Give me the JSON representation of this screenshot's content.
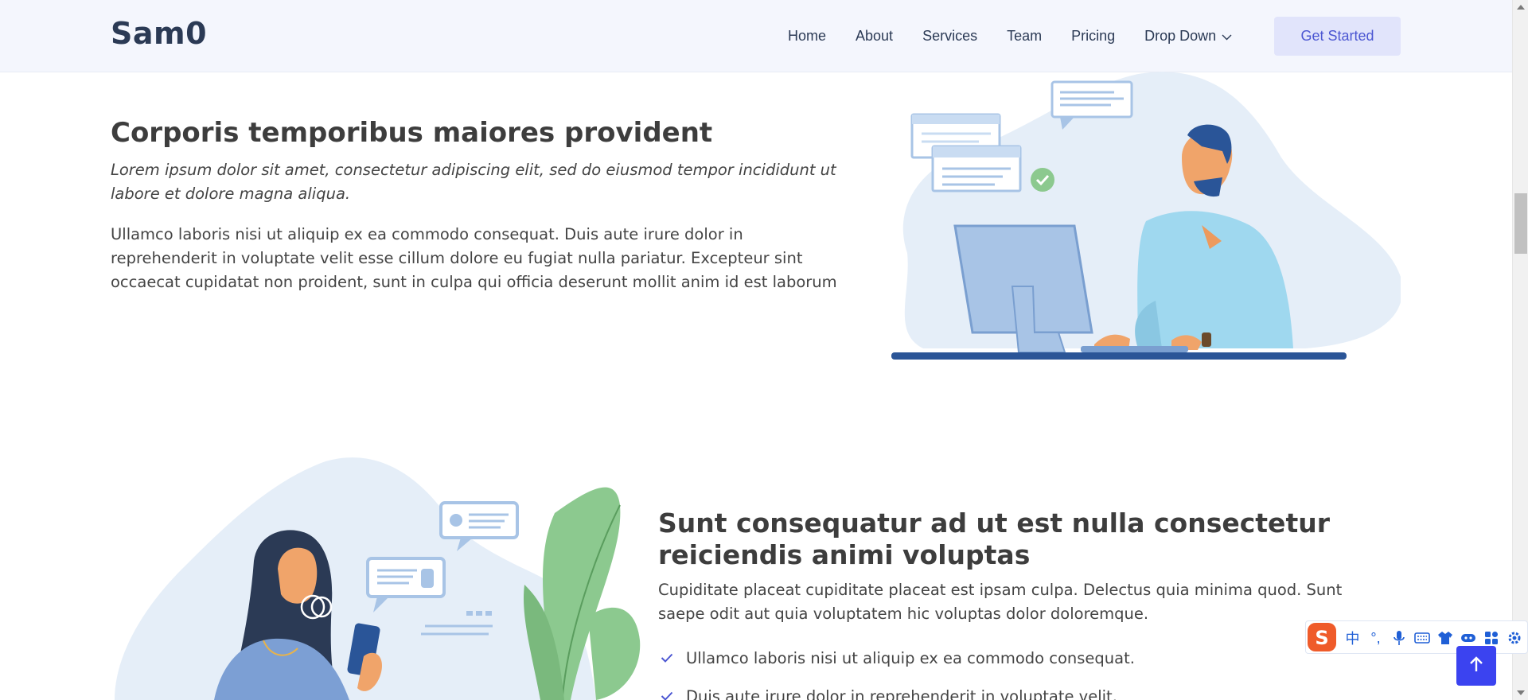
{
  "brand": {
    "name": "Sam0"
  },
  "nav": {
    "items": [
      {
        "label": "Home"
      },
      {
        "label": "About"
      },
      {
        "label": "Services"
      },
      {
        "label": "Team"
      },
      {
        "label": "Pricing"
      },
      {
        "label": "Drop Down"
      }
    ],
    "cta_label": "Get Started"
  },
  "section1": {
    "title": "Corporis temporibus maiores provident",
    "lead": "Lorem ipsum dolor sit amet, consectetur adipiscing elit, sed do eiusmod tempor incididunt ut labore et dolore magna aliqua.",
    "body": "Ullamco laboris nisi ut aliquip ex ea commodo consequat. Duis aute irure dolor in reprehenderit in voluptate velit esse cillum dolore eu fugiat nulla pariatur. Excepteur sint occaecat cupidatat non proident, sunt in culpa qui officia deserunt mollit anim id est laborum"
  },
  "section2": {
    "title": "Sunt consequatur ad ut est nulla consectetur reiciendis animi voluptas",
    "lead": "Cupiditate placeat cupiditate placeat est ipsam culpa. Delectus quia minima quod. Sunt saepe odit aut quia voluptatem hic voluptas dolor doloremque.",
    "checklist": [
      {
        "text": "Ullamco laboris nisi ut aliquip ex ea commodo consequat."
      },
      {
        "text": "Duis aute irure dolor in reprehenderit in voluptate velit."
      }
    ]
  },
  "ime": {
    "items": [
      {
        "icon": "chinese-mode-icon",
        "glyph": "中"
      },
      {
        "icon": "punctuation-icon",
        "glyph": "°,"
      },
      {
        "icon": "microphone-icon",
        "glyph": ""
      },
      {
        "icon": "keyboard-icon",
        "glyph": ""
      },
      {
        "icon": "skin-icon",
        "glyph": ""
      },
      {
        "icon": "gamepad-icon",
        "glyph": ""
      },
      {
        "icon": "apps-grid-icon",
        "glyph": ""
      },
      {
        "icon": "settings-icon",
        "glyph": ""
      }
    ]
  },
  "colors": {
    "header_bg": "#f4f6fd",
    "accent": "#4b56d2",
    "cta_bg": "#e1e4fb",
    "back_to_top": "#3b43f0",
    "heading": "#3d3d3d"
  }
}
